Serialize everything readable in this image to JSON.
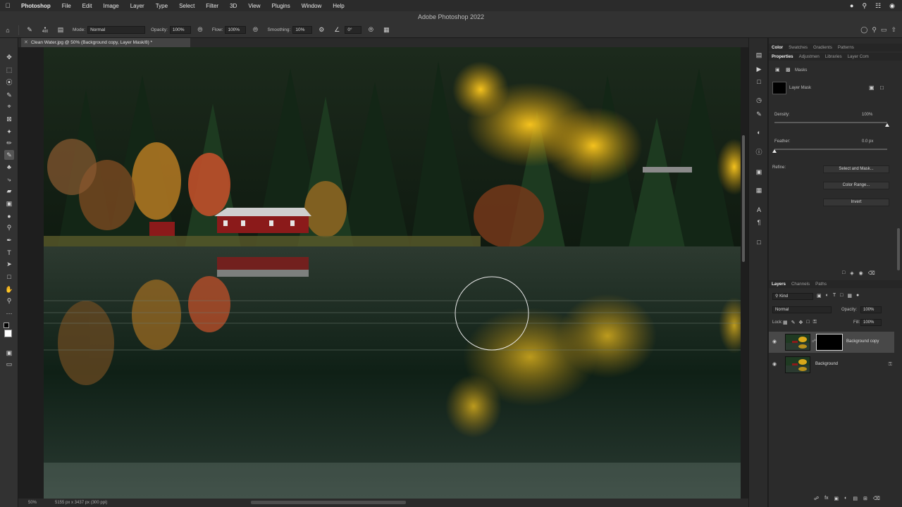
{
  "menubar": {
    "apple": "",
    "items": [
      "Photoshop",
      "File",
      "Edit",
      "Image",
      "Layer",
      "Type",
      "Select",
      "Filter",
      "3D",
      "View",
      "Plugins",
      "Window",
      "Help"
    ]
  },
  "window": {
    "title": "Adobe Photoshop 2022"
  },
  "options": {
    "brush_size": "400",
    "mode_label": "Mode:",
    "mode_value": "Normal",
    "opacity_label": "Opacity:",
    "opacity_value": "100%",
    "flow_label": "Flow:",
    "flow_value": "100%",
    "smoothing_label": "Smoothing:",
    "smoothing_value": "10%",
    "angle_value": "0°"
  },
  "document": {
    "tab_title": "Clean Water.jpg @ 50% (Background copy, Layer Mask/8) *",
    "zoom": "50%",
    "dims": "5155 px x 3437 px (300 ppi)"
  },
  "properties": {
    "tabs_top": [
      "Color",
      "Swatches",
      "Gradients",
      "Patterns"
    ],
    "tabs_second": [
      "Properties",
      "Adjustmen",
      "Libraries",
      "Layer Com"
    ],
    "masks_label": "Masks",
    "layer_mask_label": "Layer Mask",
    "density_label": "Density:",
    "density_value": "100%",
    "density_level": 1.0,
    "feather_label": "Feather:",
    "feather_value": "0.0 px",
    "feather_level": 0.0,
    "refine_label": "Refine:",
    "select_and_mask": "Select and Mask...",
    "color_range": "Color Range...",
    "invert": "Invert"
  },
  "layers": {
    "tabs": [
      "Layers",
      "Channels",
      "Paths"
    ],
    "kind_label": "Kind",
    "blend_mode": "Normal",
    "opacity_label": "Opacity:",
    "opacity_value": "100%",
    "lock_label": "Lock:",
    "fill_label": "Fill:",
    "fill_value": "100%",
    "items": [
      {
        "name": "Background copy",
        "selected": true
      },
      {
        "name": "Background",
        "selected": false
      }
    ]
  },
  "colors": {
    "accent": "#3a3a3a",
    "panel_bg": "#2b2b2b"
  }
}
